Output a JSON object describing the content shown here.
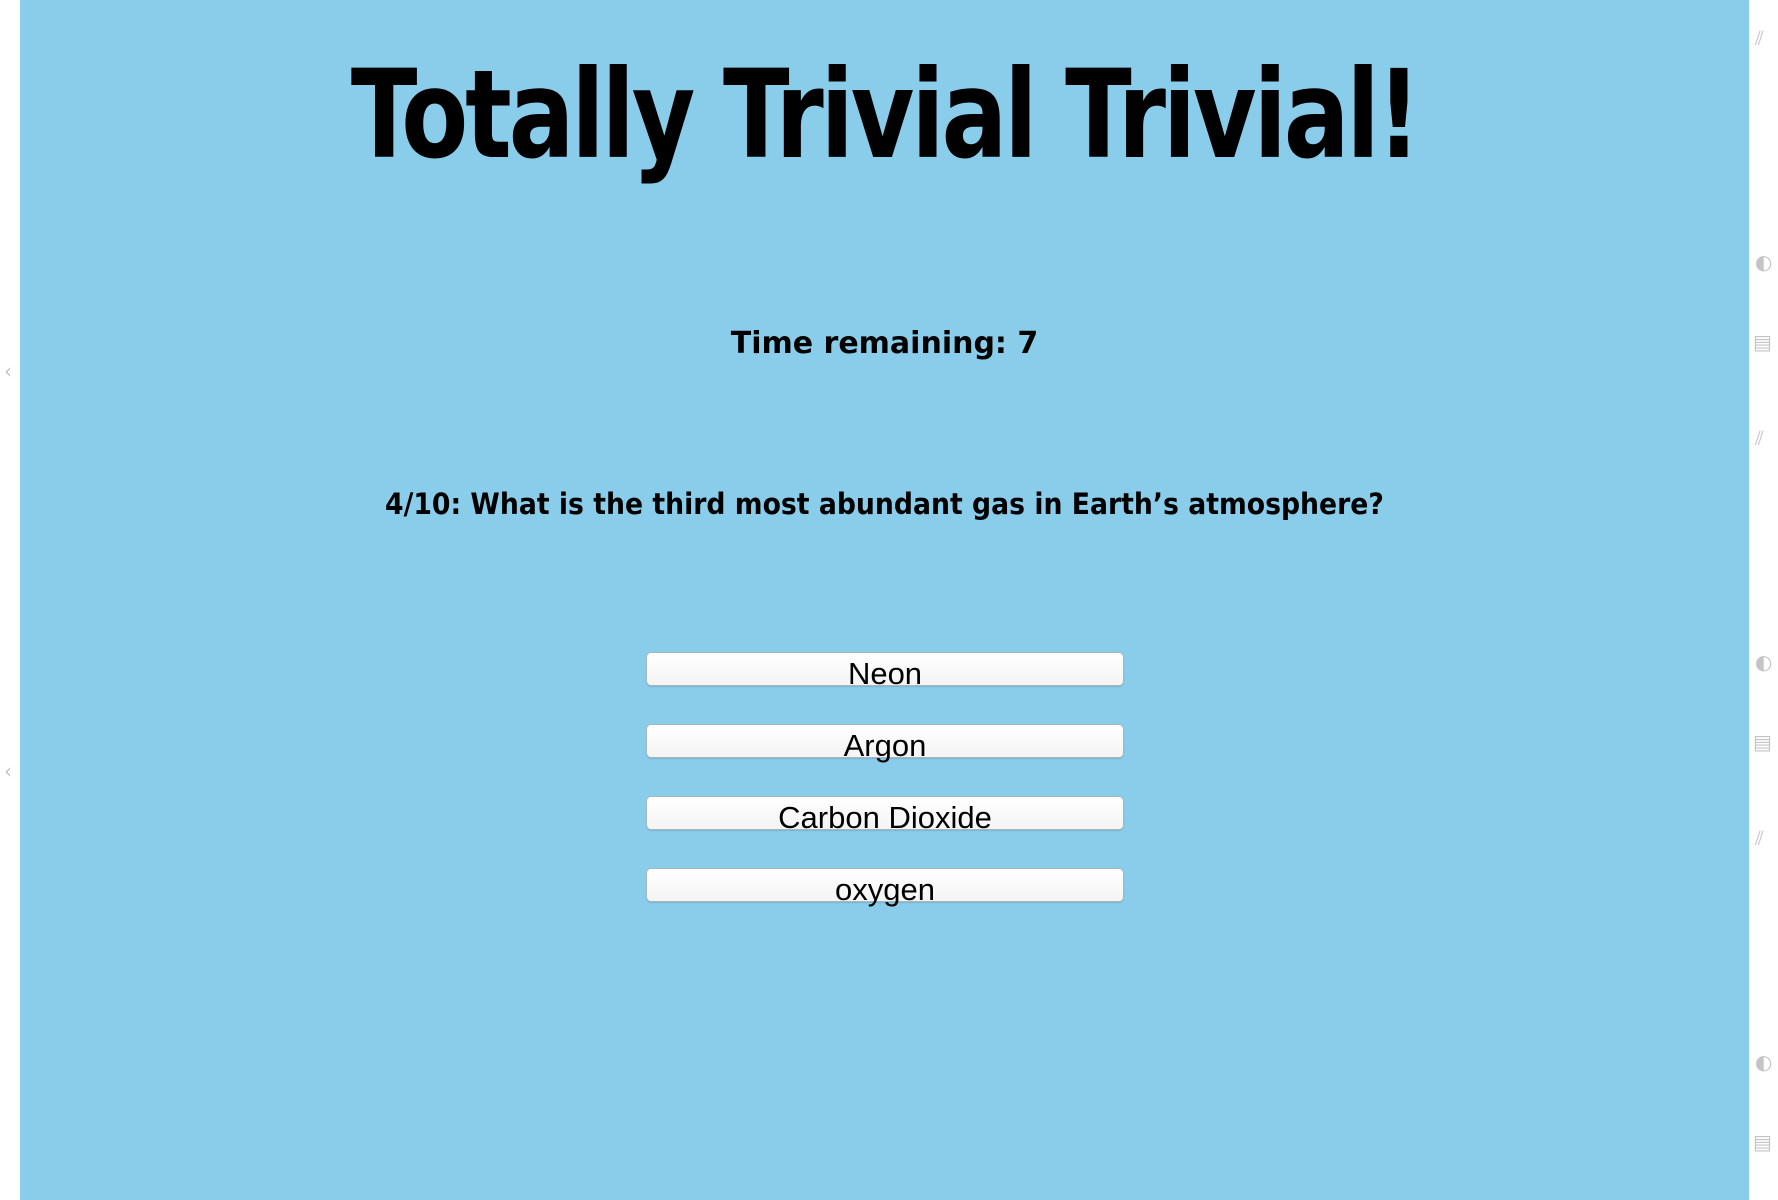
{
  "colors": {
    "panel_background": "#89cdea",
    "text": "#000000",
    "button_background": "#ffffff",
    "button_border": "#a9b6bd",
    "page_background": "#ffffff",
    "edge_icon": "#c4c4c4"
  },
  "header": {
    "title": "Totally Trivial Trivial!"
  },
  "timer": {
    "label": "Time remaining: 7"
  },
  "question": {
    "text": "4/10: What is the third most abundant gas in Earth’s atmosphere?"
  },
  "answers": [
    {
      "label": "Neon"
    },
    {
      "label": "Argon"
    },
    {
      "label": "Carbon Dioxide"
    },
    {
      "label": "oxygen"
    }
  ],
  "edge_icons": {
    "left": [
      "chevron-left-icon",
      "chevron-left-icon"
    ],
    "right": [
      "resize-grip-icon",
      "circle-icon",
      "printer-icon",
      "resize-grip-icon",
      "circle-icon",
      "printer-icon",
      "resize-grip-icon",
      "circle-icon",
      "printer-icon"
    ]
  }
}
